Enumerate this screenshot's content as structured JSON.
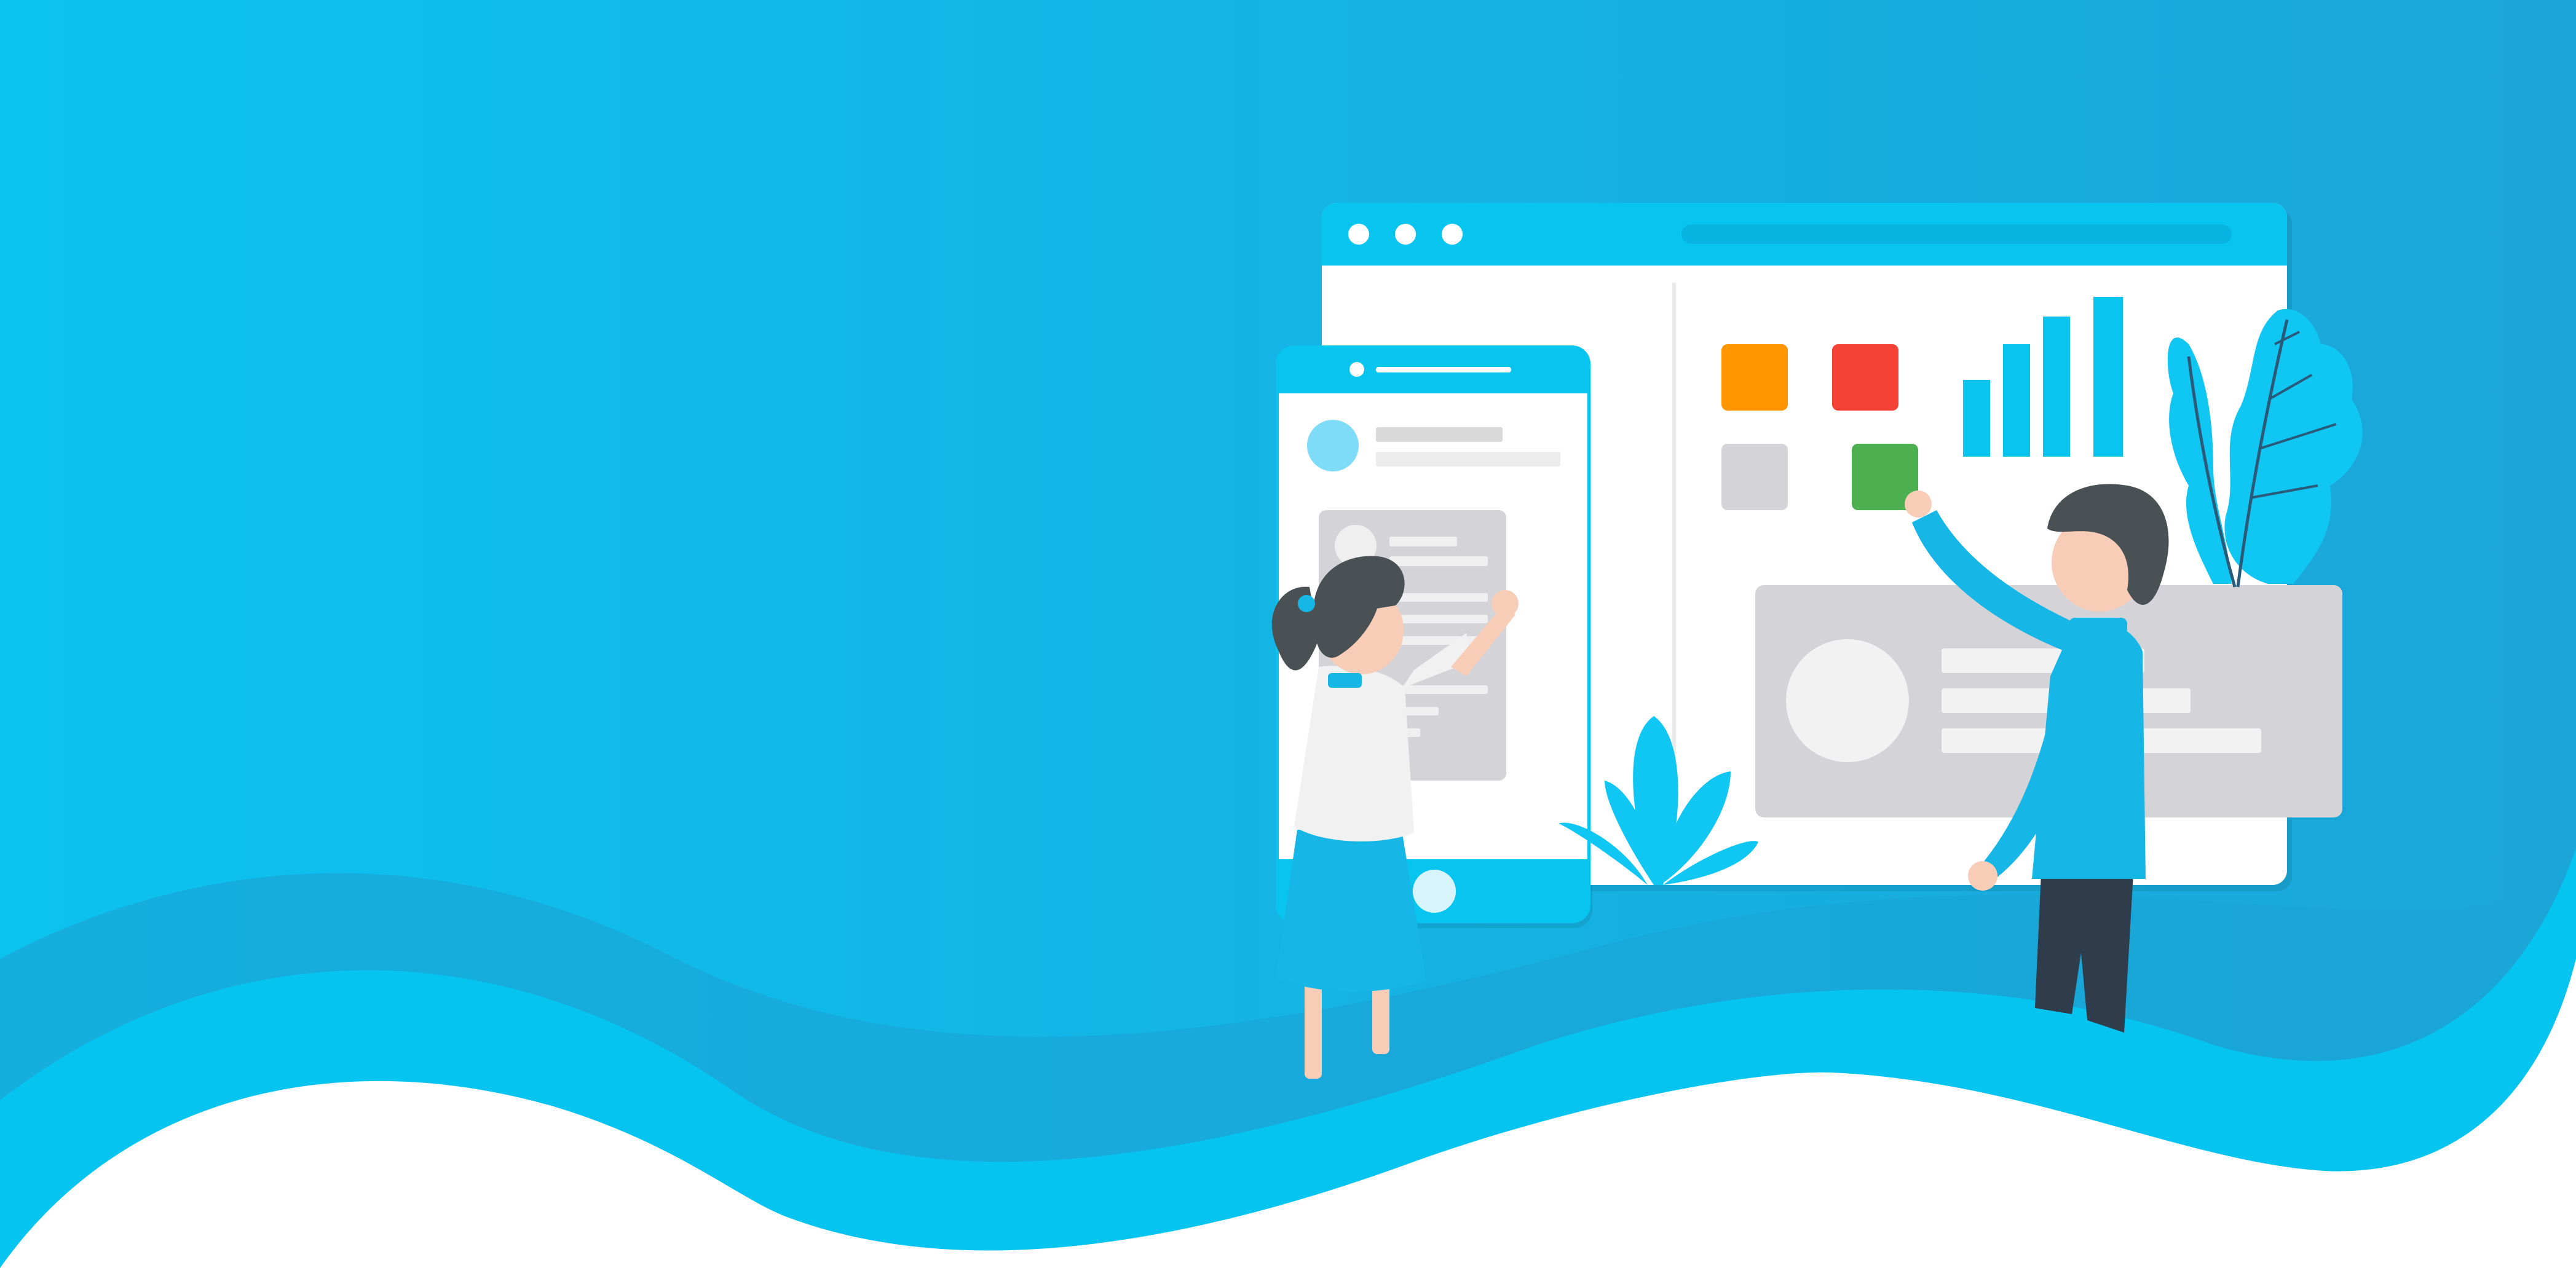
{
  "palette": {
    "background_gradient": [
      "#0cc2ef",
      "#1ba6d8"
    ],
    "wave_back": "#1aa5d6",
    "wave_front": "#06c4f0",
    "page_bottom": "#ffffff",
    "browser_bar": "#08c5f0",
    "browser_body": "#ffffff",
    "placeholder_gray": "#d4d4d8",
    "placeholder_light": "#f2f2f2",
    "tile_orange": "#ff9600",
    "tile_red": "#f44336",
    "tile_green": "#4caf50",
    "bar_blue": "#08c5f0",
    "plant_blue": "#0fc7f2",
    "hair": "#4a5154",
    "skin": "#f7cdb8",
    "shirt_white": "#f1f1f1",
    "shirt_blue": "#16b6e6",
    "trousers": "#2f3c4c"
  }
}
